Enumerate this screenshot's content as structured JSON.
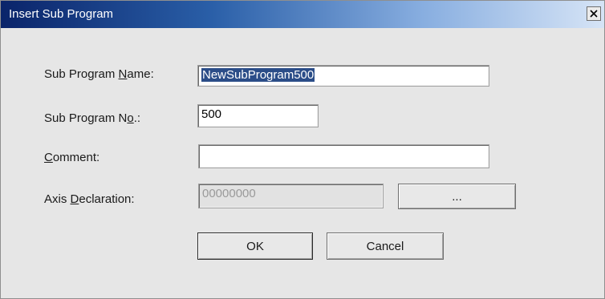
{
  "window": {
    "title": "Insert Sub Program",
    "close_icon": "close-icon"
  },
  "form": {
    "name": {
      "label_pre": "Sub Program ",
      "label_key": "N",
      "label_post": "ame:",
      "value": "NewSubProgram500"
    },
    "number": {
      "label_pre": "Sub Program N",
      "label_key": "o",
      "label_post": ".:",
      "value": "500"
    },
    "comment": {
      "label_pre": "",
      "label_key": "C",
      "label_post": "omment:",
      "value": ""
    },
    "axis": {
      "label_pre": "Axis ",
      "label_key": "D",
      "label_post": "eclaration:",
      "value": "00000000",
      "browse_label": "..."
    }
  },
  "buttons": {
    "ok": "OK",
    "cancel": "Cancel"
  }
}
